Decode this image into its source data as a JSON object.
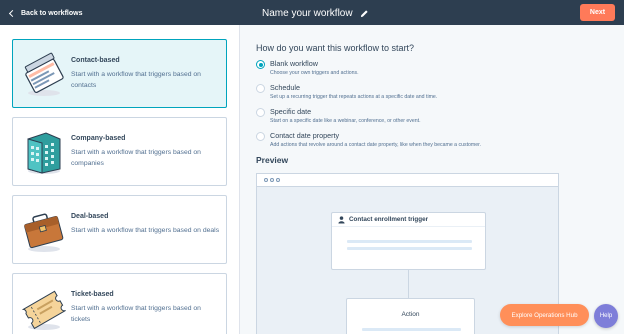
{
  "header": {
    "back_label": "Back to workflows",
    "title": "Name your workflow",
    "next_label": "Next"
  },
  "workflow_types": [
    {
      "title": "Contact-based",
      "description": "Start with a workflow that triggers based on contacts",
      "icon": "contact-card-icon",
      "selected": true
    },
    {
      "title": "Company-based",
      "description": "Start with a workflow that triggers based on companies",
      "icon": "building-icon",
      "selected": false
    },
    {
      "title": "Deal-based",
      "description": "Start with a workflow that triggers based on deals",
      "icon": "briefcase-icon",
      "selected": false
    },
    {
      "title": "Ticket-based",
      "description": "Start with a workflow that triggers based on tickets",
      "icon": "ticket-icon",
      "selected": false
    }
  ],
  "start_section": {
    "question": "How do you want this workflow to start?",
    "options": [
      {
        "label": "Blank workflow",
        "description": "Choose your own triggers and actions.",
        "selected": true
      },
      {
        "label": "Schedule",
        "description": "Set up a recurring trigger that repeats actions at a specific date and time.",
        "selected": false
      },
      {
        "label": "Specific date",
        "description": "Start on a specific date like a webinar, conference, or other event.",
        "selected": false
      },
      {
        "label": "Contact date property",
        "description": "Add actions that revolve around a contact date property, like when they became a customer.",
        "selected": false
      }
    ]
  },
  "preview": {
    "heading": "Preview",
    "trigger_label": "Contact enrollment trigger",
    "action_label": "Action"
  },
  "floating": {
    "explore_label": "Explore Operations Hub",
    "help_label": "Help"
  },
  "colors": {
    "topbar": "#2d3e50",
    "accent_orange": "#ff7a59",
    "accent_teal": "#00a4bd",
    "help_purple": "#7e7ed9"
  }
}
